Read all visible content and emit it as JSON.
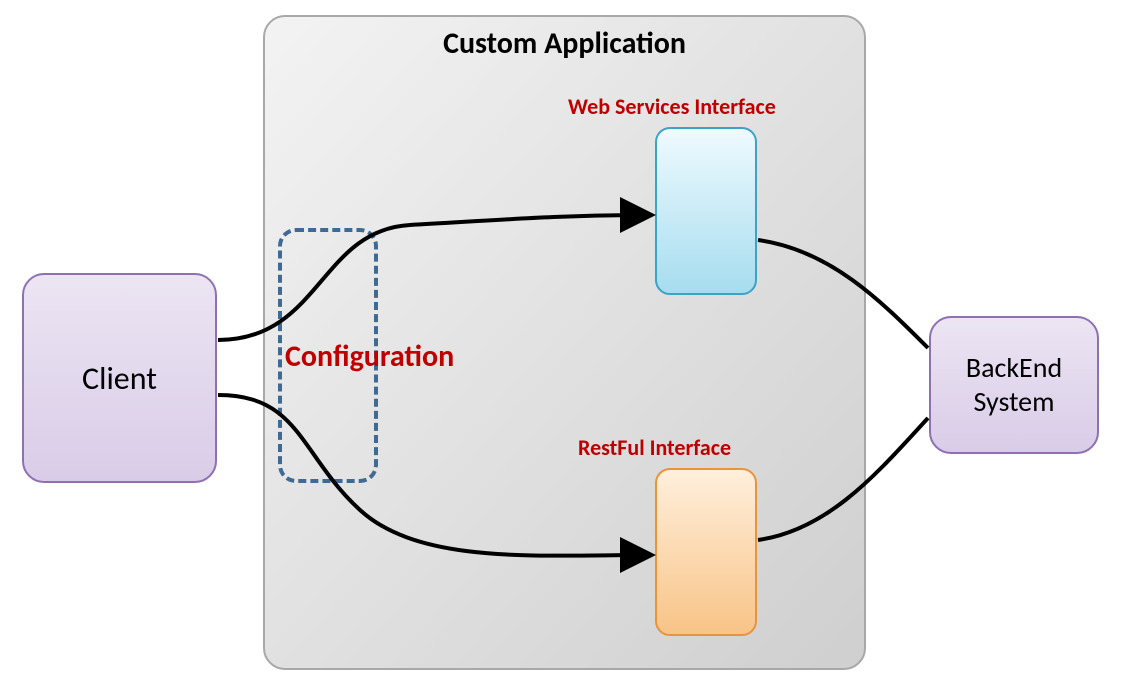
{
  "client": {
    "label": "Client"
  },
  "app": {
    "title": "Custom Application",
    "configuration_label": "Configuration",
    "web_services_label": "Web Services Interface",
    "restful_label": "RestFul Interface"
  },
  "backend": {
    "label": "BackEnd\nSystem"
  }
}
